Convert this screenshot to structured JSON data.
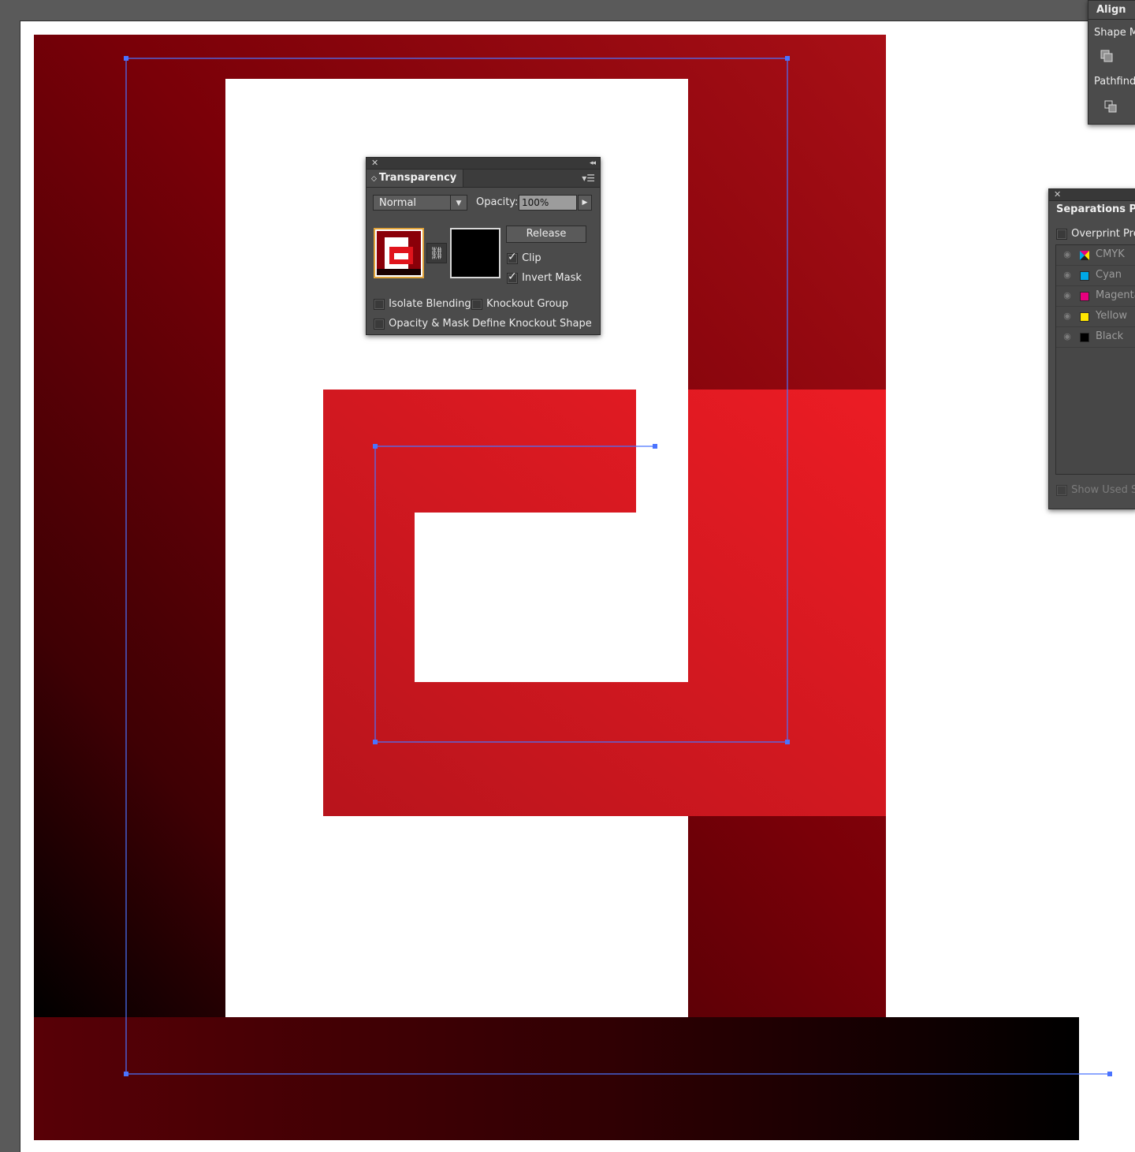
{
  "transparency_panel": {
    "title": "Transparency",
    "blend_mode": "Normal",
    "opacity_label": "Opacity:",
    "opacity_value": "100%",
    "release_label": "Release",
    "clip_label": "Clip",
    "clip_checked": true,
    "invert_mask_label": "Invert Mask",
    "invert_mask_checked": true,
    "isolate_blending_label": "Isolate Blending",
    "isolate_blending_checked": false,
    "knockout_group_label": "Knockout Group",
    "knockout_group_checked": false,
    "opacity_mask_label": "Opacity & Mask Define Knockout Shape",
    "opacity_mask_checked": false
  },
  "align_panel": {
    "tab_label": "Align",
    "shape_modes_label": "Shape Mo",
    "pathfinder_label": "Pathfinde"
  },
  "separations_panel": {
    "title": "Separations Pre",
    "overprint_label": "Overprint Prev",
    "inks": [
      {
        "name": "CMYK",
        "color": "multi"
      },
      {
        "name": "Cyan",
        "color": "#00a8e8"
      },
      {
        "name": "Magenta",
        "color": "#e6007e"
      },
      {
        "name": "Yellow",
        "color": "#ffe600"
      },
      {
        "name": "Black",
        "color": "#000000"
      }
    ],
    "show_used_label": "Show Used Sp"
  },
  "colors": {
    "dark_red": "#8a0009",
    "bright_red": "#ec1c24",
    "selection_blue": "#4a73ff"
  }
}
